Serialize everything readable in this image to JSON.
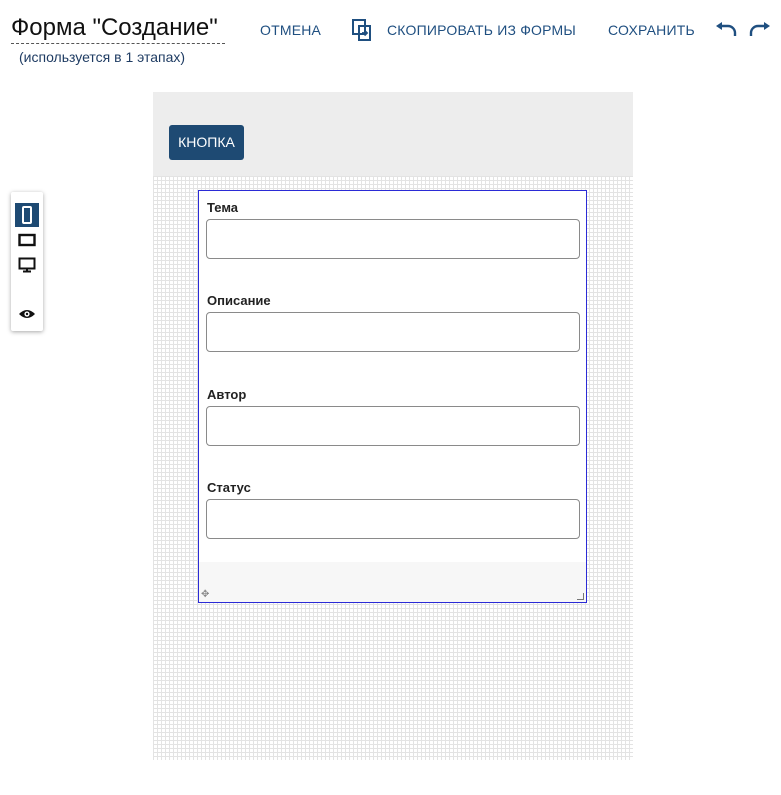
{
  "header": {
    "form_title": "Форма \"Создание\"",
    "subtitle": "(используется в 1 этапах)"
  },
  "toolbar": {
    "cancel_label": "ОТМЕНА",
    "copy_label": "СКОПИРОВАТЬ ИЗ ФОРМЫ",
    "save_label": "СОХРАНИТЬ",
    "icons": [
      "copy-icon",
      "undo-icon",
      "redo-icon"
    ]
  },
  "canvas": {
    "button_label": "КНОПКА",
    "fields": [
      {
        "label": "Тема",
        "value": ""
      },
      {
        "label": "Описание",
        "value": ""
      },
      {
        "label": "Автор",
        "value": ""
      },
      {
        "label": "Статус",
        "value": ""
      }
    ]
  },
  "view_switcher": {
    "items": [
      "phone-icon",
      "tablet-icon",
      "desktop-icon",
      "eye-icon"
    ],
    "active": "phone-icon"
  },
  "colors": {
    "accent": "#1e4a73",
    "link": "#1f4f80",
    "frame_border": "#2b2bd6",
    "header_band": "#ededed"
  }
}
